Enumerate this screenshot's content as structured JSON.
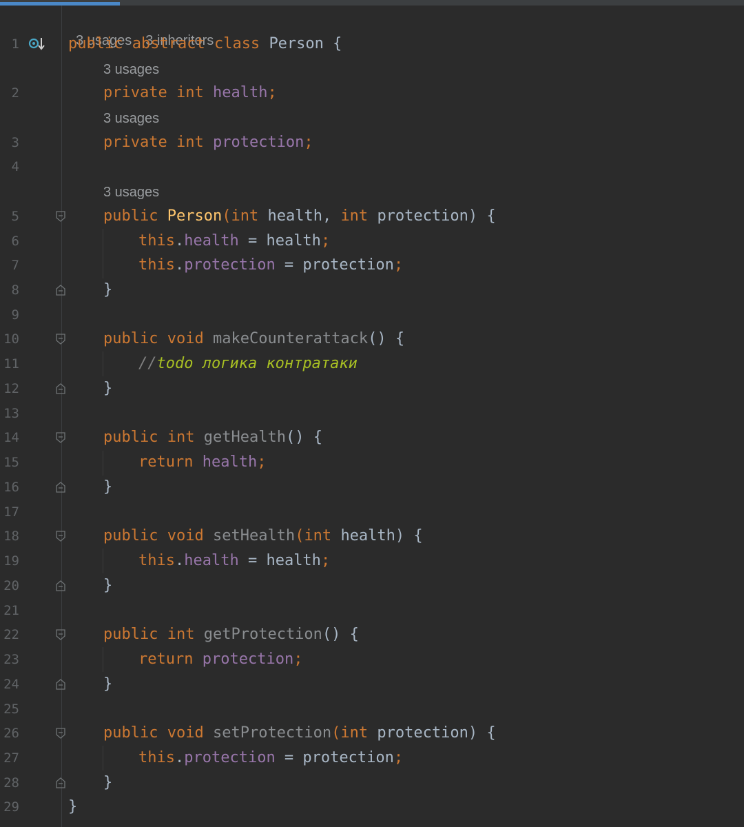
{
  "editor": {
    "class_hints": {
      "usages": "3 usages",
      "inheritors": "3 inheritors"
    },
    "field_hints": [
      "3 usages",
      "3 usages",
      "3 usages"
    ],
    "lines": [
      {
        "n": "1"
      },
      {
        "n": "2"
      },
      {
        "n": "3"
      },
      {
        "n": "4"
      },
      {
        "n": "5"
      },
      {
        "n": "6"
      },
      {
        "n": "7"
      },
      {
        "n": "8"
      },
      {
        "n": "9"
      },
      {
        "n": "10"
      },
      {
        "n": "11"
      },
      {
        "n": "12"
      },
      {
        "n": "13"
      },
      {
        "n": "14"
      },
      {
        "n": "15"
      },
      {
        "n": "16"
      },
      {
        "n": "17"
      },
      {
        "n": "18"
      },
      {
        "n": "19"
      },
      {
        "n": "20"
      },
      {
        "n": "21"
      },
      {
        "n": "22"
      },
      {
        "n": "23"
      },
      {
        "n": "24"
      },
      {
        "n": "25"
      },
      {
        "n": "26"
      },
      {
        "n": "27"
      },
      {
        "n": "28"
      },
      {
        "n": "29"
      }
    ],
    "code": {
      "l1": {
        "t1": "public",
        "t2": "abstract",
        "t3": "class",
        "t4": "Person {"
      },
      "l2": {
        "t1": "private",
        "t2": "int",
        "t3": "health",
        ";": ";"
      },
      "l3": {
        "t1": "private",
        "t2": "int",
        "t3": "protection",
        ";": ";"
      },
      "l5": {
        "t1": "public",
        "t2": "Person",
        "t3": "(",
        "t4": "int",
        "t5": "health,",
        "t6": "int",
        "t7": "protection) {"
      },
      "l6": {
        "t1": "this",
        "t2": ".",
        "t3": "health",
        "t4": " = health",
        ";": ";"
      },
      "l7": {
        "t1": "this",
        "t2": ".",
        "t3": "protection",
        "t4": " = protection",
        ";": ";"
      },
      "close": "}",
      "l10": {
        "t1": "public",
        "t2": "void",
        "t3": "makeCounterattack",
        "t4": "() {"
      },
      "l11": {
        "t1": "//",
        "t2": "todo логика контратаки"
      },
      "l14": {
        "t1": "public",
        "t2": "int",
        "t3": "getHealth",
        "t4": "() {"
      },
      "l15": {
        "t1": "return",
        "t2": "health",
        ";": ";"
      },
      "l18": {
        "t1": "public",
        "t2": "void",
        "t3": "setHealth",
        "t4": "(",
        "t5": "int",
        "t6": "health) {"
      },
      "l19": {
        "t1": "this",
        "t2": ".",
        "t3": "health",
        "t4": " = health",
        ";": ";"
      },
      "l22": {
        "t1": "public",
        "t2": "int",
        "t3": "getProtection",
        "t4": "() {"
      },
      "l23": {
        "t1": "return",
        "t2": "protection",
        ";": ";"
      },
      "l26": {
        "t1": "public",
        "t2": "void",
        "t3": "setProtection",
        "t4": "(",
        "t5": "int",
        "t6": "protection) {"
      },
      "l27": {
        "t1": "this",
        "t2": ".",
        "t3": "protection",
        "t4": " = protection",
        ";": ";"
      }
    }
  },
  "colors": {
    "background": "#2b2b2b",
    "keyword": "#cc7832",
    "field": "#9876aa",
    "constructor": "#ffc66d",
    "todo": "#a8c023",
    "line_number": "#606366"
  },
  "icons": {
    "gutter_line1": "implemented-down-icon",
    "fold_start": "fold-start-icon",
    "fold_end": "fold-end-icon"
  }
}
